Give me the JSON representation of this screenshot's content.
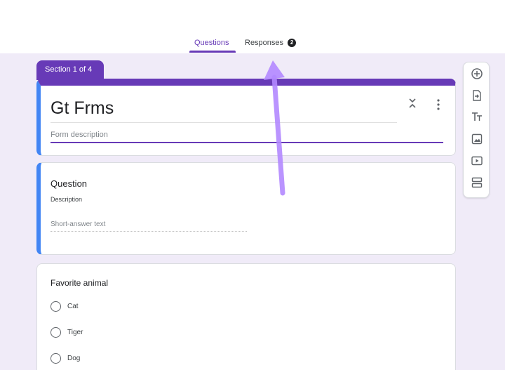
{
  "tabs": {
    "questions_label": "Questions",
    "responses_label": "Responses",
    "responses_count": "2"
  },
  "section": {
    "label": "Section 1 of 4"
  },
  "form": {
    "title": "Gt Frms",
    "description_placeholder": "Form description"
  },
  "question_card": {
    "title": "Question",
    "description": "Description",
    "answer_placeholder": "Short-answer text"
  },
  "mc_card": {
    "title": "Favorite animal",
    "options": [
      "Cat",
      "Tiger",
      "Dog"
    ]
  },
  "toolbar": {
    "items": [
      "add-question-icon",
      "import-questions-icon",
      "add-title-icon",
      "add-image-icon",
      "add-video-icon",
      "add-section-icon"
    ]
  },
  "colors": {
    "accent": "#673ab7",
    "left_border": "#4285f4",
    "canvas_bg": "#f0ebf8",
    "annotation_arrow": "#b388ff"
  }
}
